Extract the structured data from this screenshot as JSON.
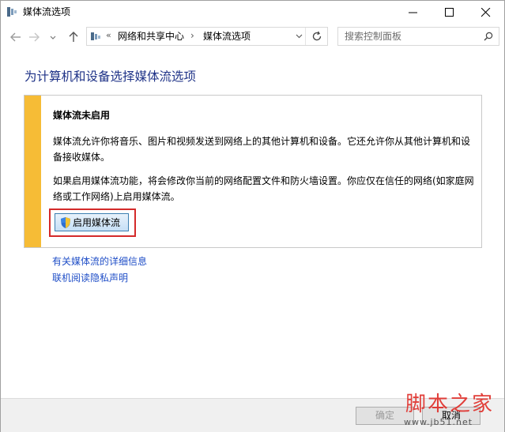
{
  "window": {
    "title": "媒体流选项"
  },
  "nav": {
    "breadcrumb_overflow": "«",
    "breadcrumbs": [
      "网络和共享中心",
      "媒体流选项"
    ],
    "search_placeholder": "搜索控制面板"
  },
  "main": {
    "page_title": "为计算机和设备选择媒体流选项",
    "panel": {
      "heading": "媒体流未启用",
      "paragraph1": "媒体流允许你将音乐、图片和视频发送到网络上的其他计算机和设备。它还允许你从其他计算机和设备接收媒体。",
      "paragraph2": "如果启用媒体流功能，将会修改你当前的网络配置文件和防火墙设置。你应仅在信任的网络(如家庭网络或工作网络)上启用媒体流。",
      "enable_button": "启用媒体流"
    },
    "links": [
      "有关媒体流的详细信息",
      "联机阅读隐私声明"
    ]
  },
  "footer": {
    "ok_label": "确定",
    "cancel_label": "取消"
  },
  "watermark": {
    "title": "脚本之家",
    "url": "www.jb51.net"
  },
  "colors": {
    "page_title": "#1e3287",
    "panel_stripe": "#f6bc36",
    "link": "#1f4ec7",
    "highlight": "#d42a2a",
    "watermark": "#e0302b"
  }
}
